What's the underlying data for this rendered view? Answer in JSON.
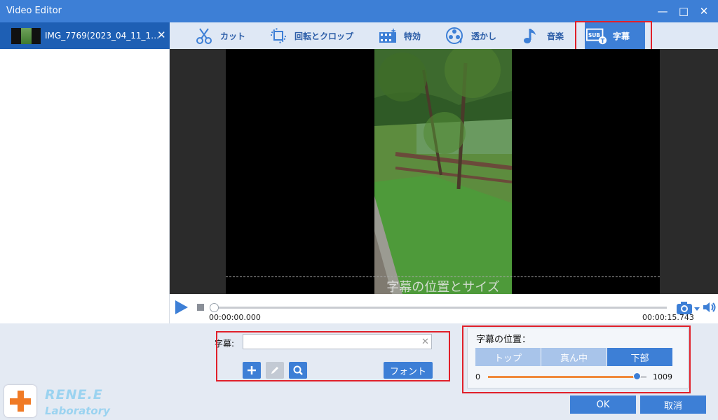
{
  "window": {
    "title": "Video Editor"
  },
  "file_tab": {
    "name": "IMG_7769(2023_04_11_1…",
    "close": "✕"
  },
  "toolbar": {
    "items": [
      {
        "label": "カット",
        "icon": "cut-icon"
      },
      {
        "label": "回転とクロップ",
        "icon": "rotate-crop-icon"
      },
      {
        "label": "特効",
        "icon": "effects-icon"
      },
      {
        "label": "透かし",
        "icon": "watermark-icon"
      },
      {
        "label": "音楽",
        "icon": "music-icon"
      },
      {
        "label": "字幕",
        "icon": "subtitle-icon",
        "active": true
      }
    ]
  },
  "preview": {
    "subtitle_placeholder": "字幕の位置とサイズ"
  },
  "playback": {
    "current_time": "00:00:00.000",
    "total_time": "00:00:15.743",
    "progress": 0
  },
  "subtitle": {
    "label": "字幕:",
    "input_value": "",
    "font_button": "フォント"
  },
  "position": {
    "title": "字幕の位置：",
    "options": [
      "トップ",
      "真ん中",
      "下部"
    ],
    "selected": "下部",
    "slider_min": "0",
    "slider_max": "1009",
    "slider_value_fraction": 0.94
  },
  "footer": {
    "ok": "OK",
    "cancel": "取消"
  },
  "brand": {
    "name": "RENE.E",
    "sub": "Laboratory"
  },
  "colors": {
    "accent": "#3d7fd6",
    "highlight": "#e0202a",
    "slider_fill": "#f08a3c"
  }
}
